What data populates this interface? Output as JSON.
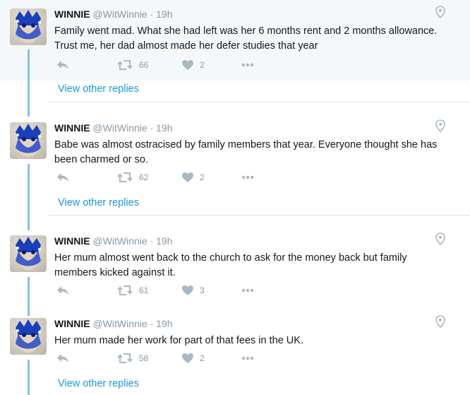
{
  "tweets": [
    {
      "name": "WINNIE",
      "handle": "@WitWinnie",
      "separator": "·",
      "time": "19h",
      "text": "Family went mad. What she had left was her 6 months rent and 2 months allowance. Trust me, her dad almost made her defer studies that year",
      "retweets": "66",
      "likes": "2"
    },
    {
      "name": "WINNIE",
      "handle": "@WitWinnie",
      "separator": "·",
      "time": "19h",
      "text": "Babe was almost ostracised by family members that year. Everyone thought she has been charmed or so.",
      "retweets": "62",
      "likes": "2"
    },
    {
      "name": "WINNIE",
      "handle": "@WitWinnie",
      "separator": "·",
      "time": "19h",
      "text": "Her mum almost went back to the church to ask for the money back but family members kicked against it.",
      "retweets": "61",
      "likes": "3"
    },
    {
      "name": "WINNIE",
      "handle": "@WitWinnie",
      "separator": "·",
      "time": "19h",
      "text": "Her mum made her work for part of that fees in the UK.",
      "retweets": "58",
      "likes": "2"
    }
  ],
  "view_other_replies": "View other replies",
  "icons": [
    "reply-icon",
    "retweet-icon",
    "like-icon",
    "more-icon",
    "location-pin-icon"
  ],
  "colors": {
    "link": "#1b95e0",
    "thread_line": "#7fc4ec",
    "highlight_bg": "#f5f8fa",
    "muted": "#8899a6",
    "divider": "#e1e8ed"
  }
}
